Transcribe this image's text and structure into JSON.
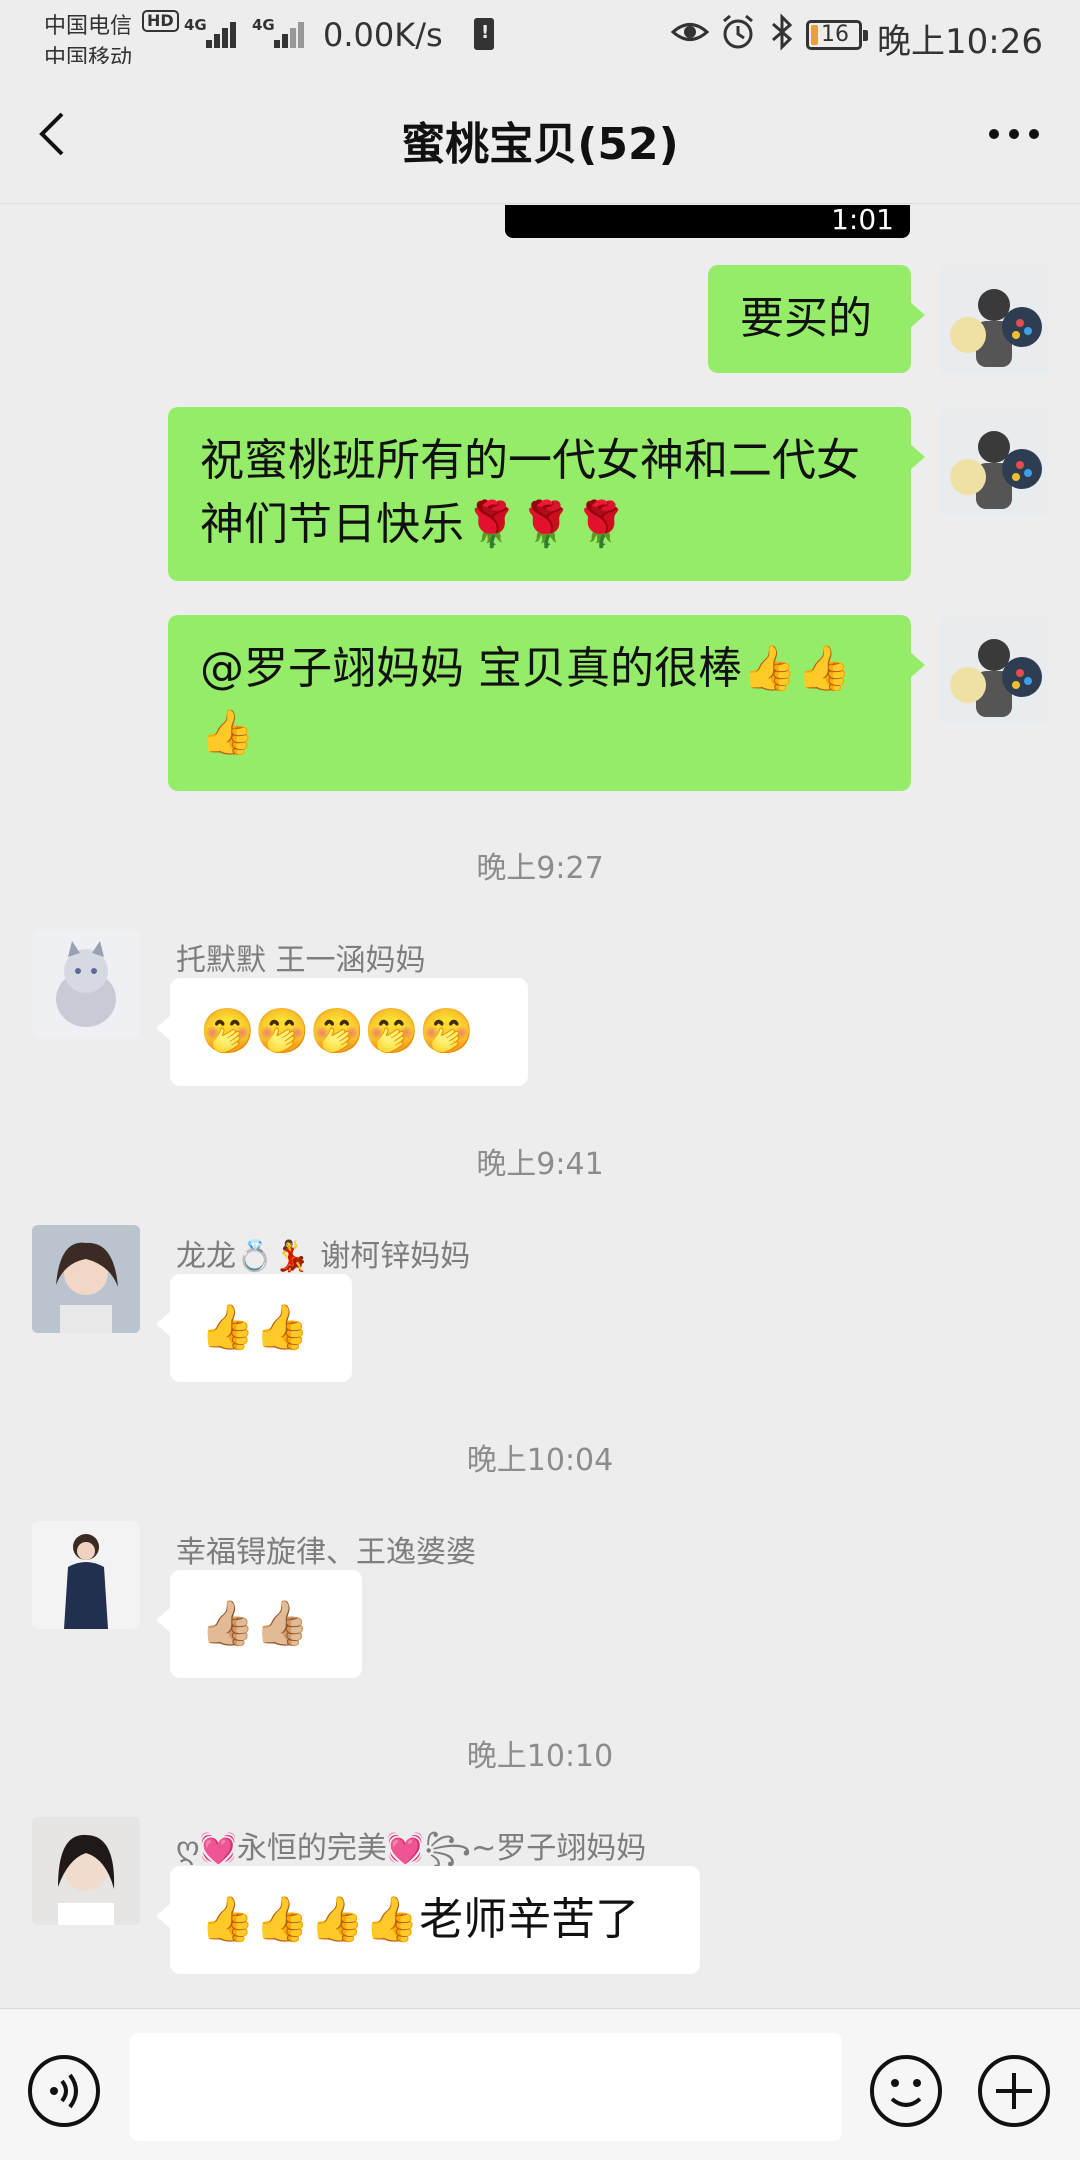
{
  "status_bar": {
    "carrier_1": "中国电信",
    "carrier_2": "中国移动",
    "hd_badge": "HD",
    "network_1": "4G",
    "network_2": "4G",
    "net_speed": "0.00K/s",
    "battery_level": "16",
    "time": "晚上10:26",
    "icons": [
      "eye-icon",
      "alarm-icon",
      "bluetooth-icon"
    ]
  },
  "header": {
    "title": "蜜桃宝贝(52)"
  },
  "video_duration": "1:01",
  "messages": {
    "m1": {
      "text": "要买的"
    },
    "m2": {
      "text": "祝蜜桃班所有的一代女神和二代女神们节日快乐🌹🌹🌹"
    },
    "m3": {
      "text": "@罗子翊妈妈  宝贝真的很棒👍👍👍"
    },
    "t1": "晚上9:27",
    "m4": {
      "sender": "托默默  王一涵妈妈",
      "text": "🤭🤭🤭🤭🤭"
    },
    "t2": "晚上9:41",
    "m5": {
      "sender": "龙龙💍💃  谢柯锌妈妈",
      "text": "👍👍"
    },
    "t3": "晚上10:04",
    "m6": {
      "sender": "幸福锝旋律、王逸婆婆",
      "text": "👍🏼👍🏼"
    },
    "t4": "晚上10:10",
    "m7": {
      "sender": "ღ💓永恒的完美💓꧂~罗子翊妈妈",
      "text": "👍👍👍👍老师辛苦了"
    }
  },
  "input_bar": {
    "placeholder": ""
  },
  "colors": {
    "background": "#ededed",
    "my_bubble": "#95ec69",
    "other_bubble": "#ffffff",
    "battery_accent": "#e8a03a"
  }
}
